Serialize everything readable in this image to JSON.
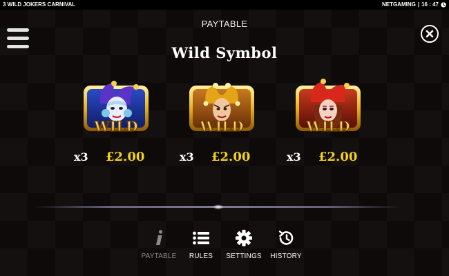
{
  "top_bar": {
    "game_title": "3 WILD JOKERS CARNIVAL",
    "provider": "NETGAMING",
    "separator": "|",
    "time": "16 : 47",
    "clock_icon": "clock-icon"
  },
  "header": {
    "title": "PAYTABLE",
    "menu_icon": "hamburger-menu-icon",
    "close_icon": "close-icon"
  },
  "section": {
    "title": "Wild Symbol"
  },
  "symbols": [
    {
      "badge": "WILD",
      "theme": "blue",
      "frame_color": "#1e3a8a",
      "mult": "x3",
      "amount": "£2.00"
    },
    {
      "badge": "WILD",
      "theme": "gold",
      "frame_color": "#b8641a",
      "mult": "x3",
      "amount": "£2.00"
    },
    {
      "badge": "WILD",
      "theme": "red",
      "frame_color": "#a32416",
      "mult": "x3",
      "amount": "£2.00"
    }
  ],
  "colors": {
    "payout": "#f3d21a",
    "background": "#0f0a0a",
    "active_nav": "#8a8a8a"
  },
  "nav": {
    "paytable": {
      "label": "PAYTABLE",
      "icon": "info-icon",
      "active": true
    },
    "rules": {
      "label": "RULES",
      "icon": "list-icon"
    },
    "settings": {
      "label": "SETTINGS",
      "icon": "gear-icon"
    },
    "history": {
      "label": "HISTORY",
      "icon": "history-icon"
    }
  }
}
